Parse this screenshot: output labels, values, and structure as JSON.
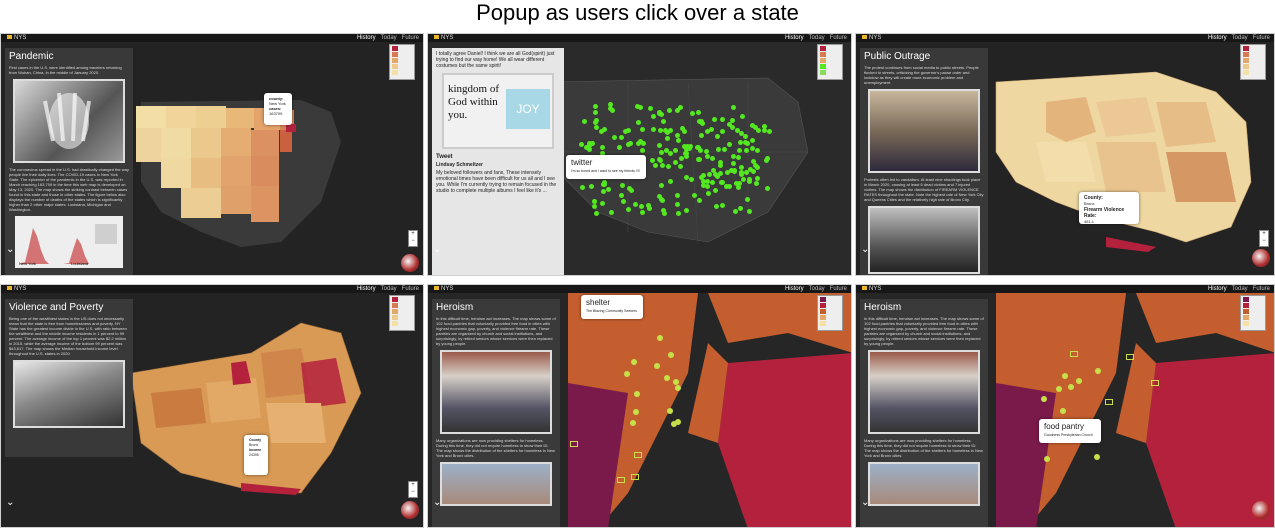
{
  "caption": "Popup as users click over a state",
  "app": {
    "logo": "NYS",
    "nav": [
      "History",
      "Today",
      "Future"
    ]
  },
  "colors": {
    "ramp": [
      "#f6e1a4",
      "#edc98a",
      "#db8e5a",
      "#cf5c3c",
      "#b4213d",
      "#7a1a4a"
    ],
    "dark_land": "#2b2b2b",
    "water": "#222222",
    "point_green": "#53e81f",
    "point_yellow": "#c6e04a"
  },
  "panels": [
    {
      "title": "Pandemic",
      "intro": "First cases in the U.S. were identified among travelers returning from Wuhan, China, in the middle of January 2020.",
      "body": "The coronavirus spread in the U.S. had drastically changed the way people live their daily lives. The COVID-19 cases in New York State. The epicenter of the pandemic in the U.S. was reported in March reaching 163,709 in the time this web map is developed on May 13, 2020. The map shows the striking contrast between cases found in this state and those in other states. The figure below also displays the number of deaths of the states which is significantly higher than 2 other major states: Louisiana, Michigan and Washington.",
      "chart_labels": [
        "New York",
        "Louisiana"
      ],
      "popup": {
        "label": "county:",
        "value": "New York",
        "label2": "cases:",
        "value2": "163709"
      }
    },
    {
      "title": "",
      "intro": "I totally agree Daniel! I think we are all God(spirit) just trying to find our way home! We all wear different costumes but the same spirit!",
      "photo_text": "kingdom of God within you.",
      "photo_text2": "JOY",
      "tweet_header": "Tweet",
      "tweet_user": "Lindsay Schmeltzer",
      "tweet_body": "My beloved followers and fans, These intensely emotional times have been difficult for us all and I see you. While I'm currently trying to remain focused in the studio to complete multiple albums I feel like it's ...",
      "popup": {
        "label": "twitter",
        "value": "I'm so bored and I want to see my friends !!!!"
      }
    },
    {
      "title": "Public Outrage",
      "intro": "The protest continues from social media to public streets. People flocked to streets, criticizing the governor's pause order and lockdow as they will create more economic problem and unemployment.",
      "body": "Protests often led to vandalism. At least nine shootings took place in March 2020, causing at least 6 dead victims and 7 injured victims. The map shows the distribution of FIREARM VIOLENCE RATES throughout the state. Note the highest rate of New York City and Queens Cities and the relatively high rate of Bronx City.",
      "popup": {
        "label": "County:",
        "value": "Bronx",
        "label2": "Firearm Violence Rate:",
        "value2": "461.1"
      }
    },
    {
      "title": "Violence and Poverty",
      "intro": "Being one of the wealthiest states in the US does not necessarily mean that the state is free from homelessness and poverty. NY State has the greatest income divide in the U.S. with ratio between the wealthiest and the middle income residents in 1 percent to 99 percent. The average income of the top 1 percent was $2.2 million in 2015, while the average income of the bottom 99 percent was $43,617. The map shows the Median household income level throughout the U.S. states in 2020.",
      "popup": {
        "label": "County",
        "value": "Bronx",
        "label2": "Income",
        "value2": "24395"
      }
    },
    {
      "title": "Heroism",
      "intro": "In this difficult time, heroism act increases. The map shows some of 102 food pantries that voluntarily provided free food in cities with highest economic gap, poverty, and violence firearm rate. These pantries are organized by church and social institutions, and surprisingly, by retired seniors whose services were then replaced by young people.",
      "body": "Many organizations are now providing shelters for homeless. During this time, they did not require homeless to show their ID. The map shows the distribution of the shelters for homeless in New York and Bronx cities.",
      "popup": {
        "label": "shelter",
        "value": "The Blazing Community Seekers"
      }
    },
    {
      "title": "Heroism",
      "intro": "In this difficult time, heroism act increases. The map shows some of 102 food pantries that voluntarily provided free food in cities with highest economic gap, poverty, and violence firearm rate. These pantries are organized by church and social institutions, and surprisingly, by retired seniors whose services were then replaced by young people.",
      "body": "Many organizations are now providing shelters for homeless. During this time, they did not require homeless to show their ID. The map shows the distribution of the shelters for homeless in New York and Bronx cities.",
      "popup": {
        "label": "food pantry",
        "value": "Goodness Presbyterian Church"
      }
    }
  ]
}
